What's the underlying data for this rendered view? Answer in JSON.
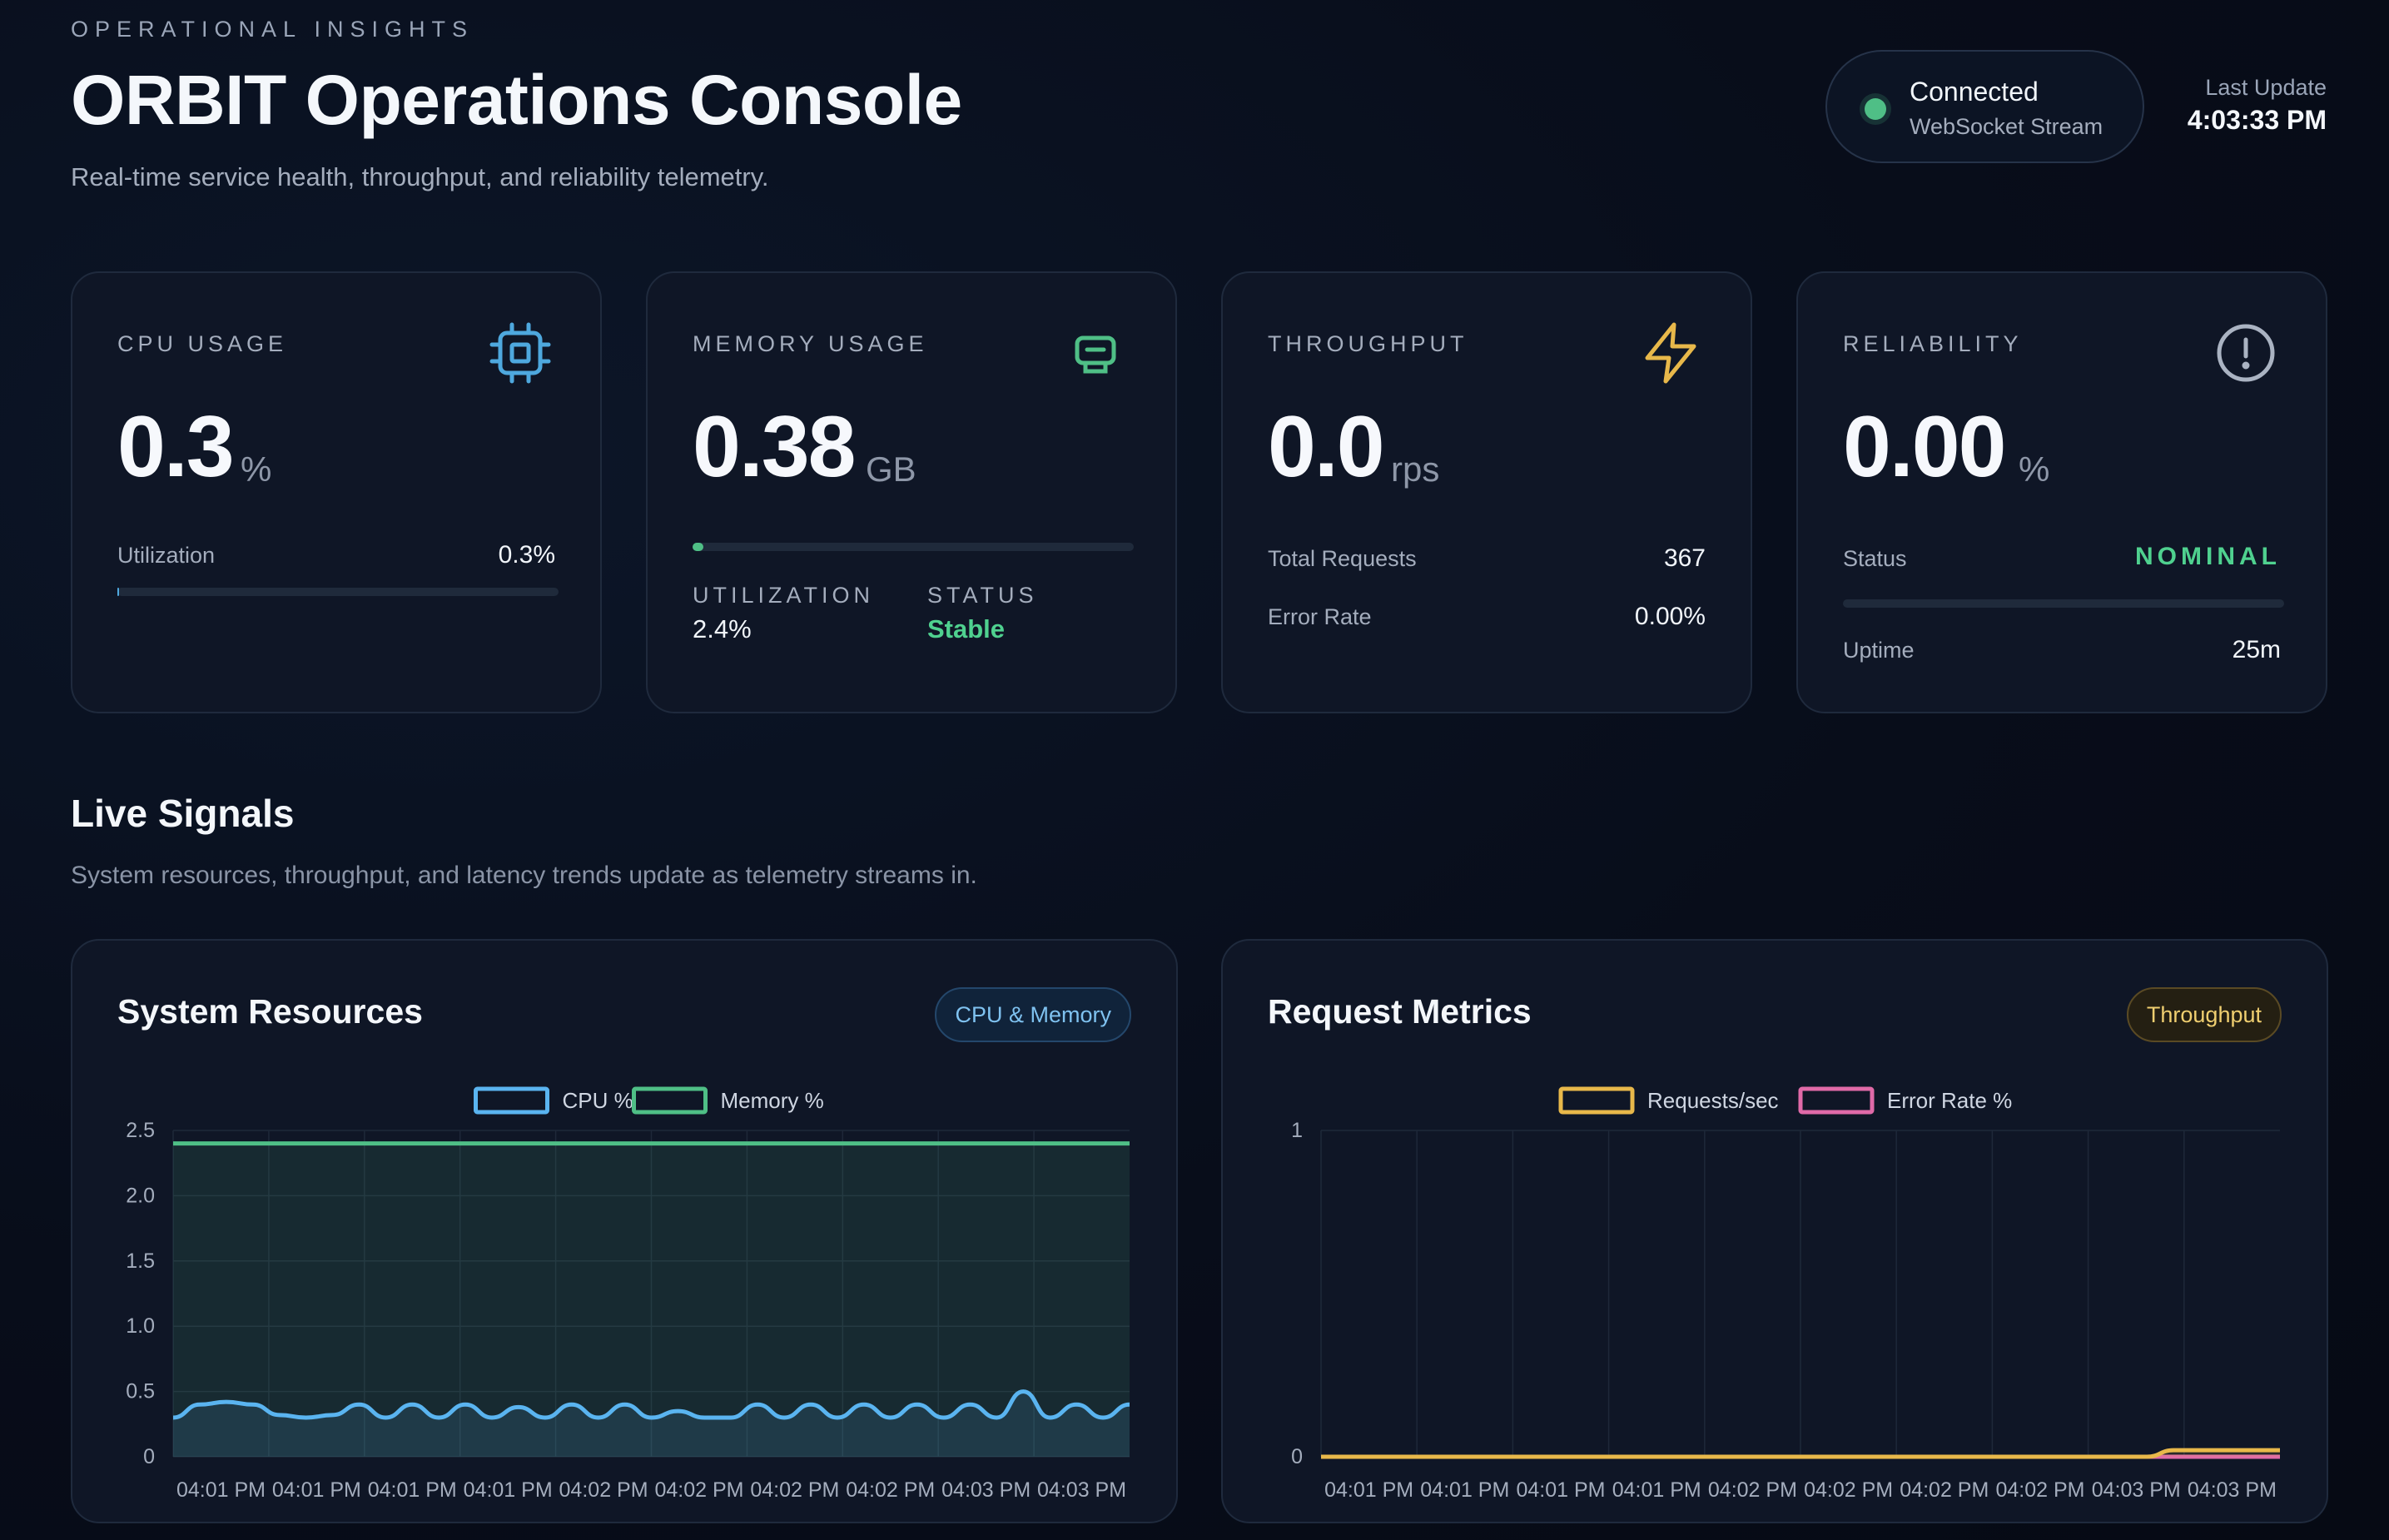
{
  "header": {
    "eyebrow": "OPERATIONAL INSIGHTS",
    "title": "ORBIT Operations Console",
    "subtitle": "Real-time service health, throughput, and reliability telemetry.",
    "connection": {
      "title": "Connected",
      "subtitle": "WebSocket Stream",
      "status_color": "#4fbf86"
    },
    "last_update": {
      "label": "Last Update",
      "time": "4:03:33 PM"
    }
  },
  "cards": {
    "cpu": {
      "label": "CPU USAGE",
      "icon": "cpu-icon",
      "value": "0.3",
      "unit": "%",
      "row_label": "Utilization",
      "row_value": "0.3%",
      "bar_fraction": 0.003,
      "accent": "#4ea8de"
    },
    "memory": {
      "label": "MEMORY USAGE",
      "icon": "memory-icon",
      "value": "0.38",
      "unit": "GB",
      "bar_fraction": 0.024,
      "util_caption": "UTILIZATION",
      "util_value": "2.4%",
      "status_caption": "STATUS",
      "status_value": "Stable",
      "accent": "#4fbf86"
    },
    "throughput": {
      "label": "THROUGHPUT",
      "icon": "lightning-icon",
      "value": "0.0",
      "unit": "rps",
      "total_label": "Total Requests",
      "total_value": "367",
      "error_label": "Error Rate",
      "error_value": "0.00%",
      "accent": "#e8b84a"
    },
    "reliability": {
      "label": "RELIABILITY",
      "icon": "alert-circle-icon",
      "value": "0.00",
      "unit": "%",
      "status_label": "Status",
      "status_value": "NOMINAL",
      "bar_fraction": 0.0,
      "uptime_label": "Uptime",
      "uptime_value": "25m",
      "accent": "#9aa5b8"
    }
  },
  "live": {
    "title": "Live Signals",
    "subtitle": "System resources, throughput, and latency trends update as telemetry streams in."
  },
  "panels": {
    "resources": {
      "title": "System Resources",
      "badge": "CPU & Memory"
    },
    "requests": {
      "title": "Request Metrics",
      "badge": "Throughput"
    }
  },
  "chart_data": [
    {
      "type": "area",
      "title": "System Resources",
      "x_labels": [
        "04:01 PM",
        "04:01 PM",
        "04:01 PM",
        "04:01 PM",
        "04:02 PM",
        "04:02 PM",
        "04:02 PM",
        "04:02 PM",
        "04:03 PM",
        "04:03 PM"
      ],
      "ylim": [
        0,
        2.5
      ],
      "yticks": [
        "2.5",
        "2.0",
        "1.5",
        "1.0",
        "0.5",
        "0"
      ],
      "legend": "top-center",
      "grid": true,
      "series": [
        {
          "name": "CPU %",
          "color": "#5ab4f0",
          "values": [
            0.3,
            0.4,
            0.42,
            0.4,
            0.32,
            0.3,
            0.32,
            0.4,
            0.3,
            0.4,
            0.3,
            0.4,
            0.3,
            0.38,
            0.3,
            0.4,
            0.3,
            0.4,
            0.3,
            0.35,
            0.3,
            0.3,
            0.4,
            0.3,
            0.4,
            0.3,
            0.4,
            0.3,
            0.4,
            0.3,
            0.4,
            0.3,
            0.5,
            0.3,
            0.4,
            0.3,
            0.4
          ]
        },
        {
          "name": "Memory %",
          "color": "#4fbf86",
          "values": [
            2.4,
            2.4,
            2.4,
            2.4,
            2.4,
            2.4,
            2.4,
            2.4,
            2.4,
            2.4,
            2.4,
            2.4,
            2.4,
            2.4,
            2.4,
            2.4,
            2.4,
            2.4,
            2.4,
            2.4,
            2.4,
            2.4,
            2.4,
            2.4,
            2.4,
            2.4,
            2.4,
            2.4,
            2.4,
            2.4,
            2.4,
            2.4,
            2.4,
            2.4,
            2.4,
            2.4,
            2.4
          ]
        }
      ]
    },
    {
      "type": "area",
      "title": "Request Metrics",
      "x_labels": [
        "04:01 PM",
        "04:01 PM",
        "04:01 PM",
        "04:01 PM",
        "04:02 PM",
        "04:02 PM",
        "04:02 PM",
        "04:02 PM",
        "04:03 PM",
        "04:03 PM"
      ],
      "ylim": [
        0,
        1
      ],
      "yticks": [
        "1",
        "0"
      ],
      "legend": "top-center",
      "grid": true,
      "series": [
        {
          "name": "Requests/sec",
          "color": "#e8b84a",
          "values": [
            0,
            0,
            0,
            0,
            0,
            0,
            0,
            0,
            0,
            0,
            0,
            0,
            0,
            0,
            0,
            0,
            0,
            0,
            0,
            0,
            0,
            0,
            0,
            0,
            0,
            0,
            0,
            0,
            0,
            0,
            0,
            0,
            0.02,
            0.02,
            0.02,
            0.02,
            0.02
          ]
        },
        {
          "name": "Error Rate %",
          "color": "#e06aa8",
          "values": [
            0,
            0,
            0,
            0,
            0,
            0,
            0,
            0,
            0,
            0,
            0,
            0,
            0,
            0,
            0,
            0,
            0,
            0,
            0,
            0,
            0,
            0,
            0,
            0,
            0,
            0,
            0,
            0,
            0,
            0,
            0,
            0,
            0,
            0,
            0,
            0,
            0
          ]
        }
      ]
    }
  ]
}
